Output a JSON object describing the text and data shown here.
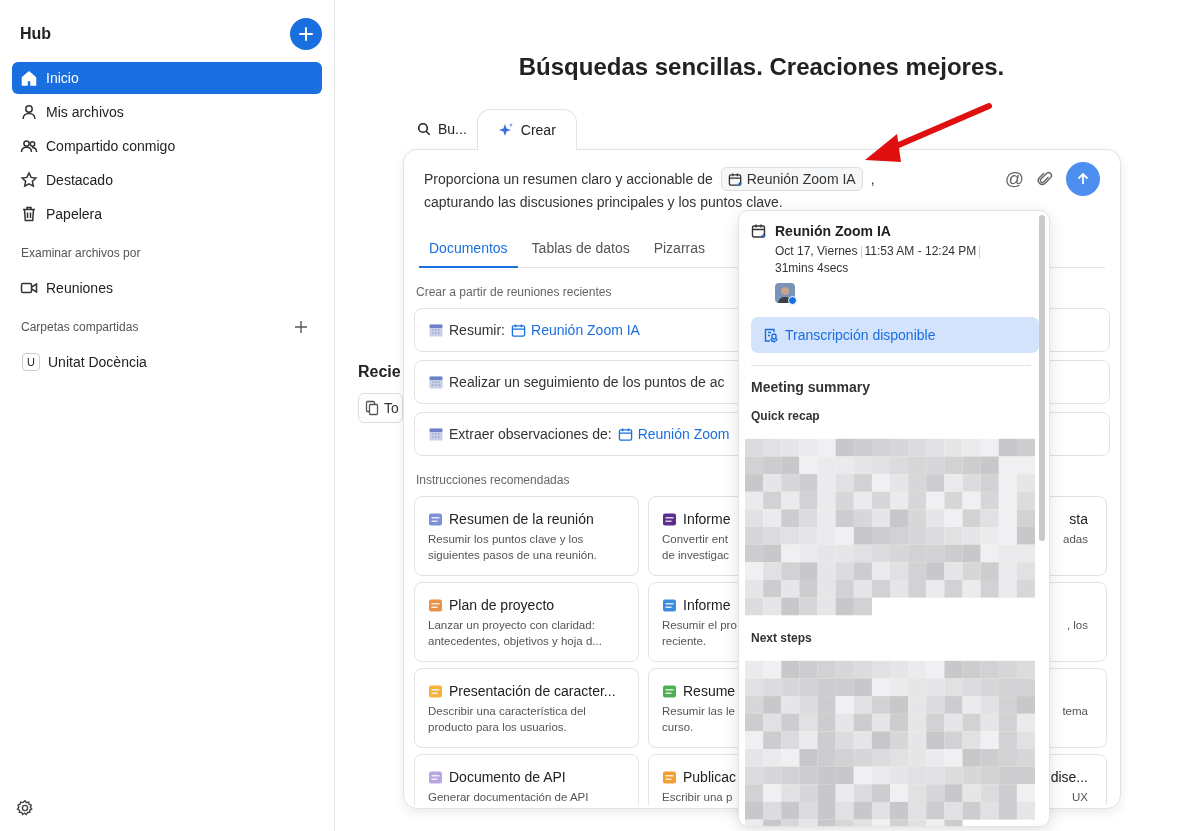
{
  "sidebar": {
    "title": "Hub",
    "items": [
      {
        "label": "Inicio",
        "selected": true
      },
      {
        "label": "Mis archivos",
        "selected": false
      },
      {
        "label": "Compartido conmigo",
        "selected": false
      },
      {
        "label": "Destacado",
        "selected": false
      },
      {
        "label": "Papelera",
        "selected": false
      }
    ],
    "browse_heading": "Examinar archivos por",
    "browse_items": [
      {
        "label": "Reuniones",
        "selected": false
      }
    ],
    "shared_heading": "Carpetas compartidas",
    "shared_folders": [
      {
        "initial": "U",
        "label": "Unitat Docència",
        "selected": false
      }
    ]
  },
  "headline": "Búsquedas sencillas. Creaciones mejores.",
  "recent": {
    "heading": "Recie",
    "filter": "To"
  },
  "mode_tabs": [
    {
      "label": "Bu...",
      "selected": false
    },
    {
      "label": "Crear",
      "selected": true
    }
  ],
  "prompt": {
    "before": "Proporciona un resumen claro y accionable de",
    "chip": "Reunión Zoom IA",
    "after": ",",
    "line2": "capturando las discusiones principales y los puntos clave.",
    "mention": "@"
  },
  "output_tabs": [
    {
      "label": "Documentos",
      "selected": true
    },
    {
      "label": "Tablas de datos",
      "selected": false
    },
    {
      "label": "Pizarras",
      "selected": false
    }
  ],
  "meetings_heading": "Crear a partir de reuniones recientes",
  "meeting_prompts": [
    {
      "text": "Resumir:",
      "meeting": "Reunión Zoom IA"
    },
    {
      "text": "Realizar un seguimiento de los puntos de ac"
    },
    {
      "text": "Extraer observaciones de:",
      "meeting": "Reunión Zoom"
    }
  ],
  "recommended_heading": "Instrucciones recomendadas",
  "templates": [
    {
      "title": "Resumen de la reunión",
      "desc_lines": [
        "Resumir los puntos clave y los",
        "siguientes pasos de una reunión."
      ]
    },
    {
      "title": "Informe",
      "desc_lines": [
        "Convertir ent",
        "de investigac"
      ]
    },
    {
      "title": "sta",
      "desc_lines": [
        "adas"
      ]
    },
    {
      "title": "Plan de proyecto",
      "desc_lines": [
        "Lanzar un proyecto con claridad:",
        "antecedentes, objetivos y hoja d..."
      ]
    },
    {
      "title": "Informe",
      "desc_lines": [
        "Resumir el pro",
        "reciente."
      ]
    },
    {
      "desc_lines": [
        ", los"
      ]
    },
    {
      "title": "Presentación de caracter...",
      "desc_lines": [
        "Describir una característica del",
        "producto para los usuarios."
      ]
    },
    {
      "title": "Resume",
      "desc_lines": [
        "Resumir las le",
        "curso."
      ]
    },
    {
      "desc_lines": [
        "tema"
      ]
    },
    {
      "title": "Documento de API",
      "desc_lines": [
        "Generar documentación de API"
      ]
    },
    {
      "title": "Publicac",
      "desc_lines": [
        "Escribir una p"
      ]
    },
    {
      "title": "dise...",
      "desc_lines": [
        "UX"
      ]
    }
  ],
  "popover": {
    "title": "Reunión Zoom IA",
    "date": "Oct 17, Viernes",
    "time": "11:53 AM - 12:24 PM",
    "duration": "31mins 4secs",
    "transcript": "Transcripción disponible",
    "summary_heading": "Meeting summary",
    "sections": [
      {
        "heading": "Quick recap"
      },
      {
        "heading": "Next steps"
      }
    ]
  }
}
